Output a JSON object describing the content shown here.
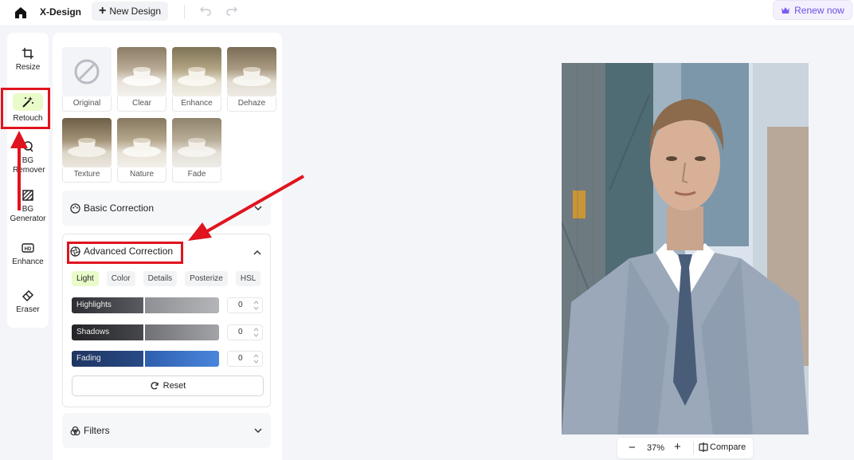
{
  "topbar": {
    "brand": "X-Design",
    "new_design_label": "New Design",
    "renew_label": "Renew now"
  },
  "tools": [
    {
      "label": "Resize",
      "icon": "crop-icon"
    },
    {
      "label": "Retouch",
      "icon": "magic-wand-icon",
      "active": true
    },
    {
      "label": "BG Remover",
      "icon": "bg-remover-icon"
    },
    {
      "label": "BG Generator",
      "icon": "bg-generator-icon"
    },
    {
      "label": "Enhance",
      "icon": "hd-icon"
    },
    {
      "label": "Eraser",
      "icon": "eraser-icon"
    }
  ],
  "presets": [
    {
      "label": "Original"
    },
    {
      "label": "Clear"
    },
    {
      "label": "Enhance"
    },
    {
      "label": "Dehaze"
    },
    {
      "label": "Texture"
    },
    {
      "label": "Nature"
    },
    {
      "label": "Fade"
    }
  ],
  "basic_correction": {
    "label": "Basic Correction"
  },
  "advanced_correction": {
    "label": "Advanced Correction",
    "tabs": [
      "Light",
      "Color",
      "Details",
      "Posterize",
      "HSL"
    ],
    "active_tab": "Light",
    "sliders": [
      {
        "label": "Highlights",
        "value": "0"
      },
      {
        "label": "Shadows",
        "value": "0"
      },
      {
        "label": "Fading",
        "value": "0"
      }
    ],
    "reset_label": "Reset"
  },
  "filters": {
    "label": "Filters"
  },
  "zoom": {
    "minus": "−",
    "value": "37%",
    "plus": "+",
    "compare_label": "Compare"
  },
  "colors": {
    "accent_green": "#e9fbc8",
    "renew_purple": "#6a4fe6",
    "annotation_red": "#e0141e"
  }
}
